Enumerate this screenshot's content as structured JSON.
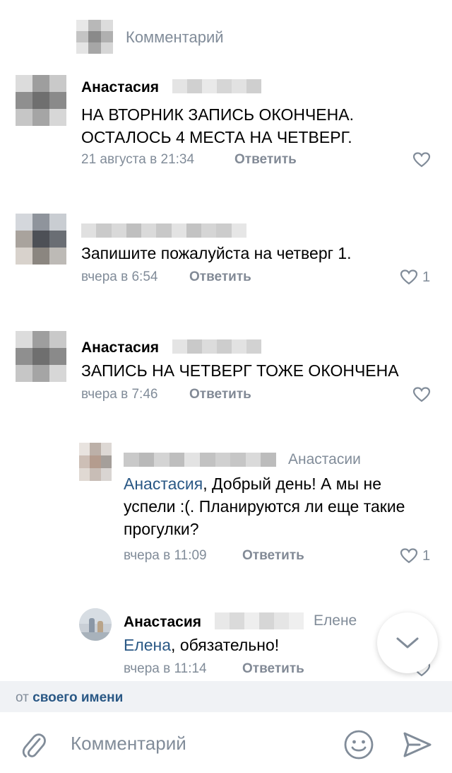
{
  "top": {
    "label": "Комментарий"
  },
  "comments": [
    {
      "author": "Анастасия",
      "text": "НА ВТОРНИК ЗАПИСЬ ОКОНЧЕНА. ОСТАЛОСЬ 4 МЕСТА НА ЧЕТВЕРГ.",
      "time": "21 августа в 21:34",
      "reply": "Ответить",
      "likes": ""
    },
    {
      "author": "",
      "text": "Запишите пожалуйста на четверг 1.",
      "time": "вчера в 6:54",
      "reply": "Ответить",
      "likes": "1"
    },
    {
      "author": "Анастасия",
      "text": "ЗАПИСЬ НА ЧЕТВЕРГ ТОЖЕ ОКОНЧЕНА",
      "time": "вчера в 7:46",
      "reply": "Ответить",
      "likes": ""
    },
    {
      "author": "",
      "reply_to": "Анастасии",
      "mention": "Анастасия",
      "text": ", Добрый день! А мы не успели :(. Планируются ли еще такие прогулки?",
      "time": "вчера в 11:09",
      "reply": "Ответить",
      "likes": "1"
    },
    {
      "author": "Анастасия",
      "reply_to": "Елене",
      "mention": "Елена",
      "text": ", обязательно!",
      "time": "вчера в 11:14",
      "reply": "Ответить",
      "likes": ""
    }
  ],
  "from_bar": {
    "prefix": "от",
    "name": "своего имени"
  },
  "composer": {
    "placeholder": "Комментарий"
  },
  "colors": {
    "link": "#2a5885",
    "secondary": "#818c99",
    "background_bar": "#f0f2f5"
  },
  "icons": [
    "avatar-pixelated",
    "heart-icon",
    "chevron-down-icon",
    "paperclip-icon",
    "smile-icon",
    "send-icon"
  ]
}
